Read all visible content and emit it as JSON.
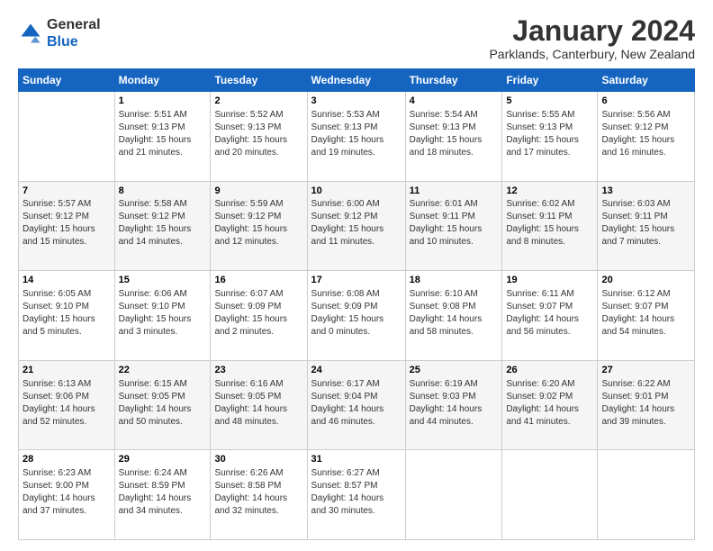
{
  "logo": {
    "general": "General",
    "blue": "Blue"
  },
  "header": {
    "month_title": "January 2024",
    "location": "Parklands, Canterbury, New Zealand"
  },
  "days_of_week": [
    "Sunday",
    "Monday",
    "Tuesday",
    "Wednesday",
    "Thursday",
    "Friday",
    "Saturday"
  ],
  "weeks": [
    [
      {
        "day": "",
        "info": ""
      },
      {
        "day": "1",
        "info": "Sunrise: 5:51 AM\nSunset: 9:13 PM\nDaylight: 15 hours\nand 21 minutes."
      },
      {
        "day": "2",
        "info": "Sunrise: 5:52 AM\nSunset: 9:13 PM\nDaylight: 15 hours\nand 20 minutes."
      },
      {
        "day": "3",
        "info": "Sunrise: 5:53 AM\nSunset: 9:13 PM\nDaylight: 15 hours\nand 19 minutes."
      },
      {
        "day": "4",
        "info": "Sunrise: 5:54 AM\nSunset: 9:13 PM\nDaylight: 15 hours\nand 18 minutes."
      },
      {
        "day": "5",
        "info": "Sunrise: 5:55 AM\nSunset: 9:13 PM\nDaylight: 15 hours\nand 17 minutes."
      },
      {
        "day": "6",
        "info": "Sunrise: 5:56 AM\nSunset: 9:12 PM\nDaylight: 15 hours\nand 16 minutes."
      }
    ],
    [
      {
        "day": "7",
        "info": "Sunrise: 5:57 AM\nSunset: 9:12 PM\nDaylight: 15 hours\nand 15 minutes."
      },
      {
        "day": "8",
        "info": "Sunrise: 5:58 AM\nSunset: 9:12 PM\nDaylight: 15 hours\nand 14 minutes."
      },
      {
        "day": "9",
        "info": "Sunrise: 5:59 AM\nSunset: 9:12 PM\nDaylight: 15 hours\nand 12 minutes."
      },
      {
        "day": "10",
        "info": "Sunrise: 6:00 AM\nSunset: 9:12 PM\nDaylight: 15 hours\nand 11 minutes."
      },
      {
        "day": "11",
        "info": "Sunrise: 6:01 AM\nSunset: 9:11 PM\nDaylight: 15 hours\nand 10 minutes."
      },
      {
        "day": "12",
        "info": "Sunrise: 6:02 AM\nSunset: 9:11 PM\nDaylight: 15 hours\nand 8 minutes."
      },
      {
        "day": "13",
        "info": "Sunrise: 6:03 AM\nSunset: 9:11 PM\nDaylight: 15 hours\nand 7 minutes."
      }
    ],
    [
      {
        "day": "14",
        "info": "Sunrise: 6:05 AM\nSunset: 9:10 PM\nDaylight: 15 hours\nand 5 minutes."
      },
      {
        "day": "15",
        "info": "Sunrise: 6:06 AM\nSunset: 9:10 PM\nDaylight: 15 hours\nand 3 minutes."
      },
      {
        "day": "16",
        "info": "Sunrise: 6:07 AM\nSunset: 9:09 PM\nDaylight: 15 hours\nand 2 minutes."
      },
      {
        "day": "17",
        "info": "Sunrise: 6:08 AM\nSunset: 9:09 PM\nDaylight: 15 hours\nand 0 minutes."
      },
      {
        "day": "18",
        "info": "Sunrise: 6:10 AM\nSunset: 9:08 PM\nDaylight: 14 hours\nand 58 minutes."
      },
      {
        "day": "19",
        "info": "Sunrise: 6:11 AM\nSunset: 9:07 PM\nDaylight: 14 hours\nand 56 minutes."
      },
      {
        "day": "20",
        "info": "Sunrise: 6:12 AM\nSunset: 9:07 PM\nDaylight: 14 hours\nand 54 minutes."
      }
    ],
    [
      {
        "day": "21",
        "info": "Sunrise: 6:13 AM\nSunset: 9:06 PM\nDaylight: 14 hours\nand 52 minutes."
      },
      {
        "day": "22",
        "info": "Sunrise: 6:15 AM\nSunset: 9:05 PM\nDaylight: 14 hours\nand 50 minutes."
      },
      {
        "day": "23",
        "info": "Sunrise: 6:16 AM\nSunset: 9:05 PM\nDaylight: 14 hours\nand 48 minutes."
      },
      {
        "day": "24",
        "info": "Sunrise: 6:17 AM\nSunset: 9:04 PM\nDaylight: 14 hours\nand 46 minutes."
      },
      {
        "day": "25",
        "info": "Sunrise: 6:19 AM\nSunset: 9:03 PM\nDaylight: 14 hours\nand 44 minutes."
      },
      {
        "day": "26",
        "info": "Sunrise: 6:20 AM\nSunset: 9:02 PM\nDaylight: 14 hours\nand 41 minutes."
      },
      {
        "day": "27",
        "info": "Sunrise: 6:22 AM\nSunset: 9:01 PM\nDaylight: 14 hours\nand 39 minutes."
      }
    ],
    [
      {
        "day": "28",
        "info": "Sunrise: 6:23 AM\nSunset: 9:00 PM\nDaylight: 14 hours\nand 37 minutes."
      },
      {
        "day": "29",
        "info": "Sunrise: 6:24 AM\nSunset: 8:59 PM\nDaylight: 14 hours\nand 34 minutes."
      },
      {
        "day": "30",
        "info": "Sunrise: 6:26 AM\nSunset: 8:58 PM\nDaylight: 14 hours\nand 32 minutes."
      },
      {
        "day": "31",
        "info": "Sunrise: 6:27 AM\nSunset: 8:57 PM\nDaylight: 14 hours\nand 30 minutes."
      },
      {
        "day": "",
        "info": ""
      },
      {
        "day": "",
        "info": ""
      },
      {
        "day": "",
        "info": ""
      }
    ]
  ]
}
